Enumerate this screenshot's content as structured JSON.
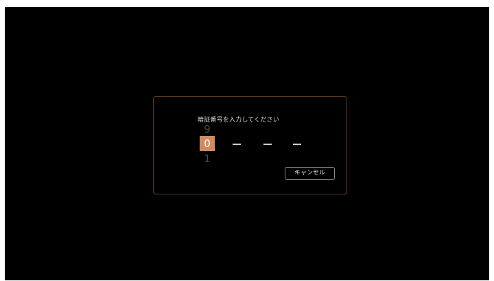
{
  "pin_dialog": {
    "prompt": "暗証番号を入力してください",
    "digit_entry": {
      "previous": "9",
      "current": "0",
      "next": "1"
    },
    "remaining_digits": [
      "—",
      "—",
      "—"
    ],
    "cancel_label": "キャンセル"
  },
  "colors": {
    "background": "#000000",
    "accent": "#d08a62",
    "dialog_border": "#5c3b25"
  }
}
